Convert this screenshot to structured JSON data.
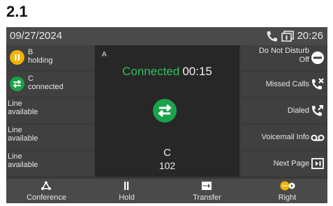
{
  "heading": "2.1",
  "status": {
    "date": "09/27/2024",
    "time": "20:26",
    "call_icon": "phone-handset-icon",
    "line_icon": "line-indicator-icon"
  },
  "calls": [
    {
      "name": "B",
      "state": "holding",
      "icon": "hold-icon",
      "color": "#f2b400"
    },
    {
      "name": "C",
      "state": "connected",
      "icon": "transfer-arrows-icon",
      "color": "#1aa34a"
    }
  ],
  "lines": [
    {
      "line1": "Line",
      "line2": "available"
    },
    {
      "line1": "Line",
      "line2": "available"
    },
    {
      "line1": "Line",
      "line2": "available"
    }
  ],
  "center": {
    "label": "A",
    "connected_text": "Connected",
    "timer": "00:15",
    "callee_name": "C",
    "callee_number": "102",
    "icon": "transfer-arrows-icon"
  },
  "right_keys": [
    {
      "line1": "Do Not Disturb",
      "line2": "Off",
      "icon": "do-not-disturb-icon"
    },
    {
      "label": "Missed Calls",
      "icon": "missed-calls-icon"
    },
    {
      "label": "Dialed",
      "icon": "dialed-calls-icon"
    },
    {
      "label": "Voicemail Info",
      "icon": "voicemail-icon"
    },
    {
      "label": "Next Page",
      "icon": "next-page-icon"
    }
  ],
  "softkeys": [
    {
      "label": "Conference",
      "icon": "conference-icon"
    },
    {
      "label": "Hold",
      "icon": "hold-icon"
    },
    {
      "label": "Transfer",
      "icon": "transfer-icon"
    },
    {
      "label": "Right",
      "icon": "more-options-icon"
    }
  ]
}
